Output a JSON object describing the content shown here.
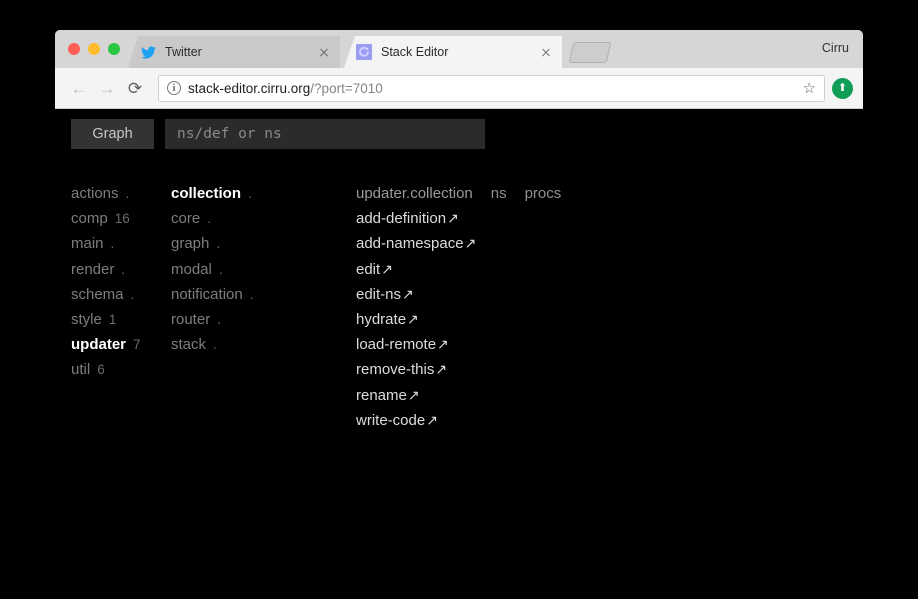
{
  "browser": {
    "profile_name": "Cirru",
    "tabs": [
      {
        "title": "Twitter",
        "favicon": "twitter-bird-icon",
        "active": false,
        "close_label": "×"
      },
      {
        "title": "Stack Editor",
        "favicon": "stack-editor-icon",
        "active": true,
        "close_label": "×"
      }
    ],
    "new_tab_label": "+",
    "nav": {
      "back": "←",
      "forward": "→",
      "reload": "⟳"
    },
    "omnibox": {
      "info_icon_glyph": "i",
      "url_host": "stack-editor.cirru.org",
      "url_path": "/?port=7010",
      "star_glyph": "☆"
    },
    "extension_badge": {
      "icon": "upload-arrow-icon",
      "glyph": "⬆",
      "color": "#0f9d58"
    }
  },
  "app": {
    "toolbar": {
      "graph_button_label": "Graph",
      "search_placeholder": "ns/def or ns",
      "search_value": ""
    },
    "namespaces": [
      {
        "label": "actions",
        "count": ".",
        "selected": false
      },
      {
        "label": "comp",
        "count": "16",
        "selected": false
      },
      {
        "label": "main",
        "count": ".",
        "selected": false
      },
      {
        "label": "render",
        "count": ".",
        "selected": false
      },
      {
        "label": "schema",
        "count": ".",
        "selected": false
      },
      {
        "label": "style",
        "count": "1",
        "selected": false
      },
      {
        "label": "updater",
        "count": "7",
        "selected": true
      },
      {
        "label": "util",
        "count": "6",
        "selected": false
      }
    ],
    "sublist": [
      {
        "label": "collection",
        "count": ".",
        "selected": true
      },
      {
        "label": "core",
        "count": ".",
        "selected": false
      },
      {
        "label": "graph",
        "count": ".",
        "selected": false
      },
      {
        "label": "modal",
        "count": ".",
        "selected": false
      },
      {
        "label": "notification",
        "count": ".",
        "selected": false
      },
      {
        "label": "router",
        "count": ".",
        "selected": false
      },
      {
        "label": "stack",
        "count": ".",
        "selected": false
      }
    ],
    "defs_header": {
      "namespace": "updater.collection",
      "tabs": [
        "ns",
        "procs"
      ]
    },
    "definitions": [
      {
        "label": "add-definition",
        "arrow": "↗"
      },
      {
        "label": "add-namespace",
        "arrow": "↗"
      },
      {
        "label": "edit",
        "arrow": "↗"
      },
      {
        "label": "edit-ns",
        "arrow": "↗"
      },
      {
        "label": "hydrate",
        "arrow": "↗"
      },
      {
        "label": "load-remote",
        "arrow": "↗"
      },
      {
        "label": "remove-this",
        "arrow": "↗"
      },
      {
        "label": "rename",
        "arrow": "↗"
      },
      {
        "label": "write-code",
        "arrow": "↗"
      }
    ]
  },
  "colors": {
    "page_background": "#000000",
    "selected_text": "#ffffff",
    "dim_text": "#7d7d7d",
    "def_text": "#dcdcdc",
    "input_background": "#2b2b2b",
    "button_background": "#333333"
  }
}
